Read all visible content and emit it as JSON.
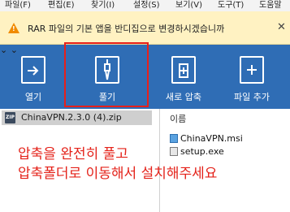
{
  "menu": [
    "파일(F)",
    "편집(E)",
    "찾기(I)",
    "설정(S)",
    "보기(V)",
    "도구(T)",
    "도움말"
  ],
  "notice": {
    "text": "RAR 파일의 기본 앱을 반디집으로 변경하시겠습니까",
    "close": "✕"
  },
  "toolbar": {
    "open_label": "열기",
    "extract_label": "풀기",
    "new_archive_label": "새로 압축",
    "add_file_label": "파일 추가",
    "dropdown_glyph": "⌄"
  },
  "archive": {
    "name": "ChinaVPN.2.3.0 (4).zip",
    "icon_label": "ZIP"
  },
  "file_list": {
    "column_name": "이름",
    "files": [
      "ChinaVPN.msi",
      "setup.exe"
    ]
  },
  "instruction": {
    "line1": "압축을 완전히 풀고",
    "line2": "압축폴더로 이동해서 설치해주세요"
  },
  "colors": {
    "toolbar_bg": "#2f6db5",
    "notice_bg": "#fff2c2",
    "highlight": "#e8201a",
    "instruction_text": "#e4221a"
  }
}
